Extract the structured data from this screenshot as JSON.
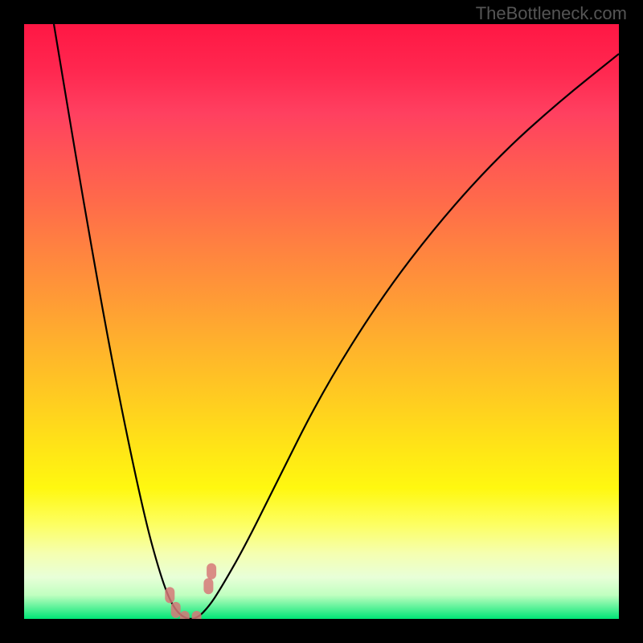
{
  "watermark": "TheBottleneck.com",
  "chart_data": {
    "type": "line",
    "title": "",
    "xlabel": "",
    "ylabel": "",
    "xlim": [
      0,
      100
    ],
    "ylim": [
      0,
      100
    ],
    "description": "V-shaped bottleneck curve with rainbow gradient background (red=high bottleneck, green=low bottleneck). Curve minimum near x≈27.",
    "series": [
      {
        "name": "bottleneck-curve",
        "x": [
          5,
          10,
          15,
          20,
          23,
          25,
          27,
          29,
          31,
          33,
          37,
          42,
          50,
          60,
          70,
          80,
          90,
          100
        ],
        "values": [
          100,
          70,
          42,
          18,
          7,
          2,
          0,
          0,
          2,
          5,
          12,
          22,
          38,
          54,
          67,
          78,
          87,
          95
        ]
      }
    ],
    "data_points": {
      "name": "highlighted-points",
      "x": [
        24.5,
        25.5,
        27,
        29,
        31,
        31.5
      ],
      "values": [
        4,
        1.5,
        0,
        0,
        5.5,
        8
      ]
    }
  },
  "colors": {
    "curve": "#000000",
    "points": "#d67878",
    "gradient_top": "#ff1744",
    "gradient_bottom": "#00e676",
    "background": "#000000"
  }
}
